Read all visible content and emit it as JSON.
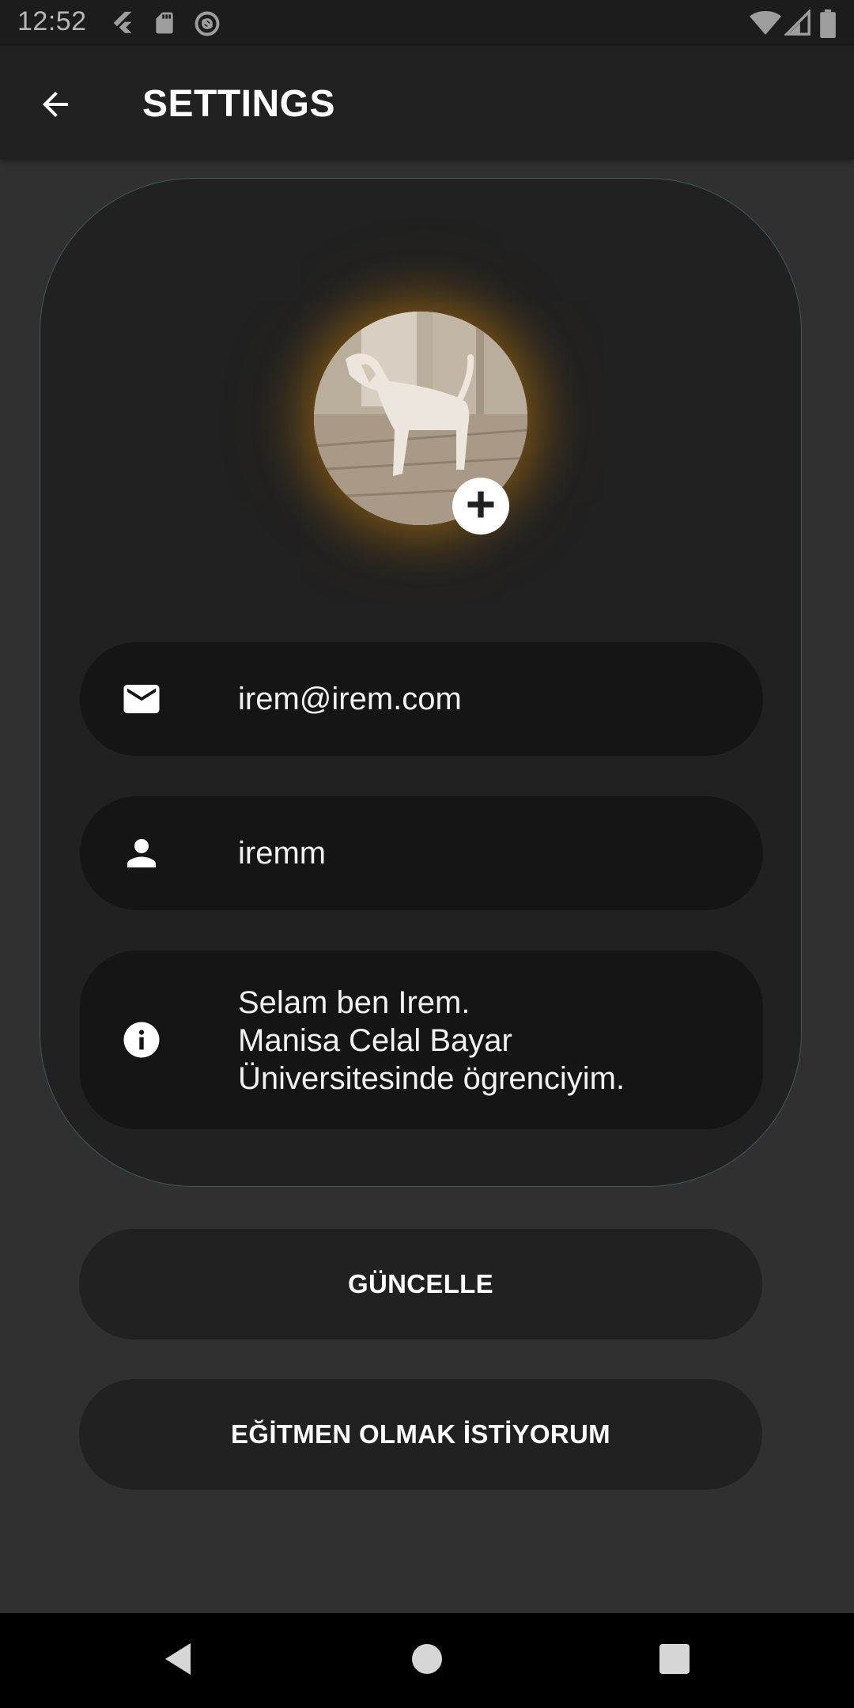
{
  "status_bar": {
    "time": "12:52",
    "left_icons": [
      "flutter-icon",
      "sd-card-icon",
      "sync-icon"
    ],
    "right_icons": [
      "wifi-icon",
      "cell-signal-icon",
      "battery-icon"
    ]
  },
  "app_bar": {
    "title": "SETTINGS",
    "back_icon": "arrow-back-icon"
  },
  "profile": {
    "avatar_icon": "dog-photo",
    "add_photo_icon": "plus-icon",
    "email": "irem@irem.com",
    "username": "iremm",
    "bio": "Selam ben Irem.\nManisa Celal Bayar Üniversitesinde ögrenciyim."
  },
  "buttons": {
    "update": "GÜNCELLE",
    "instructor": "EĞİTMEN OLMAK İSTİYORUM"
  },
  "nav_bar": {
    "icons": [
      "nav-back-icon",
      "nav-home-icon",
      "nav-recents-icon"
    ]
  },
  "colors": {
    "background": "#303030",
    "card": "#212121",
    "field": "#151515",
    "glow": "#ffa000",
    "text": "#ffffff"
  }
}
